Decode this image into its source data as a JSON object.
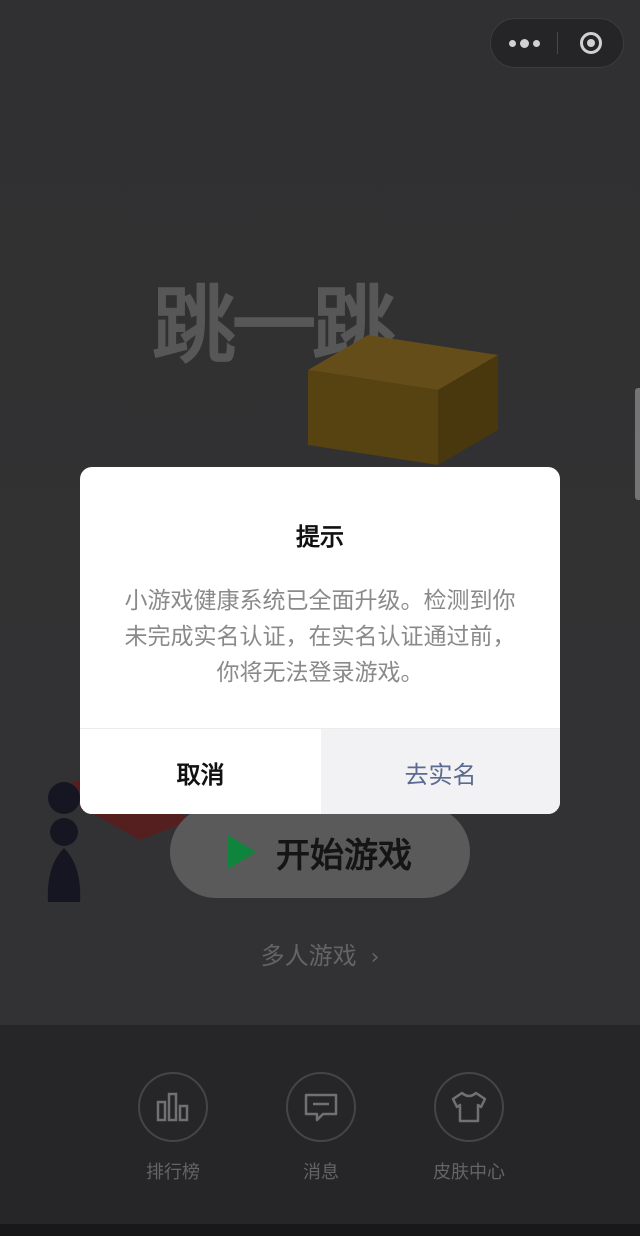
{
  "header": {
    "more_icon": "more-dots-icon",
    "close_icon": "target-close-icon"
  },
  "game": {
    "logo_text": "跳一跳",
    "start_label": "开始游戏",
    "multiplayer_label": "多人游戏",
    "accent_color": "#12a24a"
  },
  "dialog": {
    "title": "提示",
    "message": "小游戏健康系统已全面升级。检测到你未完成实名认证，在实名认证通过前，你将无法登录游戏。",
    "cancel_label": "取消",
    "confirm_label": "去实名",
    "confirm_color": "#5b6a92"
  },
  "tabbar": {
    "items": [
      {
        "label": "排行榜",
        "icon": "bar-chart-icon"
      },
      {
        "label": "消息",
        "icon": "message-icon"
      },
      {
        "label": "皮肤中心",
        "icon": "tshirt-icon"
      }
    ]
  }
}
